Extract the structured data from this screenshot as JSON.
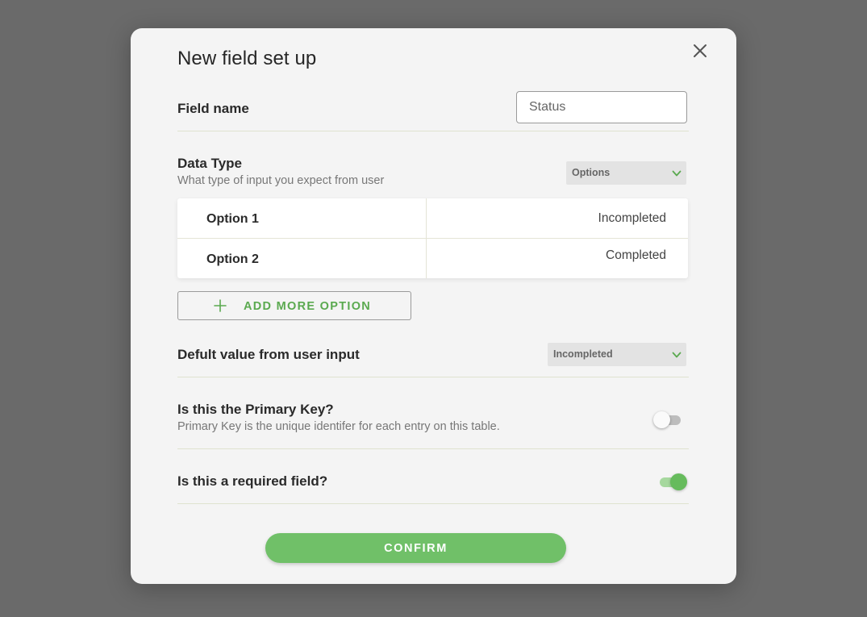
{
  "modal": {
    "title": "New field set up",
    "close_icon": "close-icon"
  },
  "field_name": {
    "label": "Field name",
    "value": "Status"
  },
  "data_type": {
    "label": "Data Type",
    "description": "What type of input you expect from user",
    "selected": "Options",
    "chevron_icon": "chevron-down-icon"
  },
  "options": [
    {
      "name": "Option 1",
      "value": "Incompleted"
    },
    {
      "name": "Option 2",
      "value": "Completed"
    }
  ],
  "add_option": {
    "label": "ADD MORE OPTION",
    "icon": "plus-icon"
  },
  "default_value": {
    "label": "Defult value from user input",
    "selected": "Incompleted"
  },
  "primary_key": {
    "label": "Is this the Primary Key?",
    "description": "Primary Key is the unique identifer for each entry on this table.",
    "enabled": false
  },
  "required_field": {
    "label": "Is this a required field?",
    "enabled": true
  },
  "confirm": {
    "label": "CONFIRM"
  },
  "colors": {
    "accent": "#70c068",
    "accent_text": "#5aa94f",
    "backdrop": "#6a6a6a",
    "modal_bg": "#f4f4f4"
  }
}
